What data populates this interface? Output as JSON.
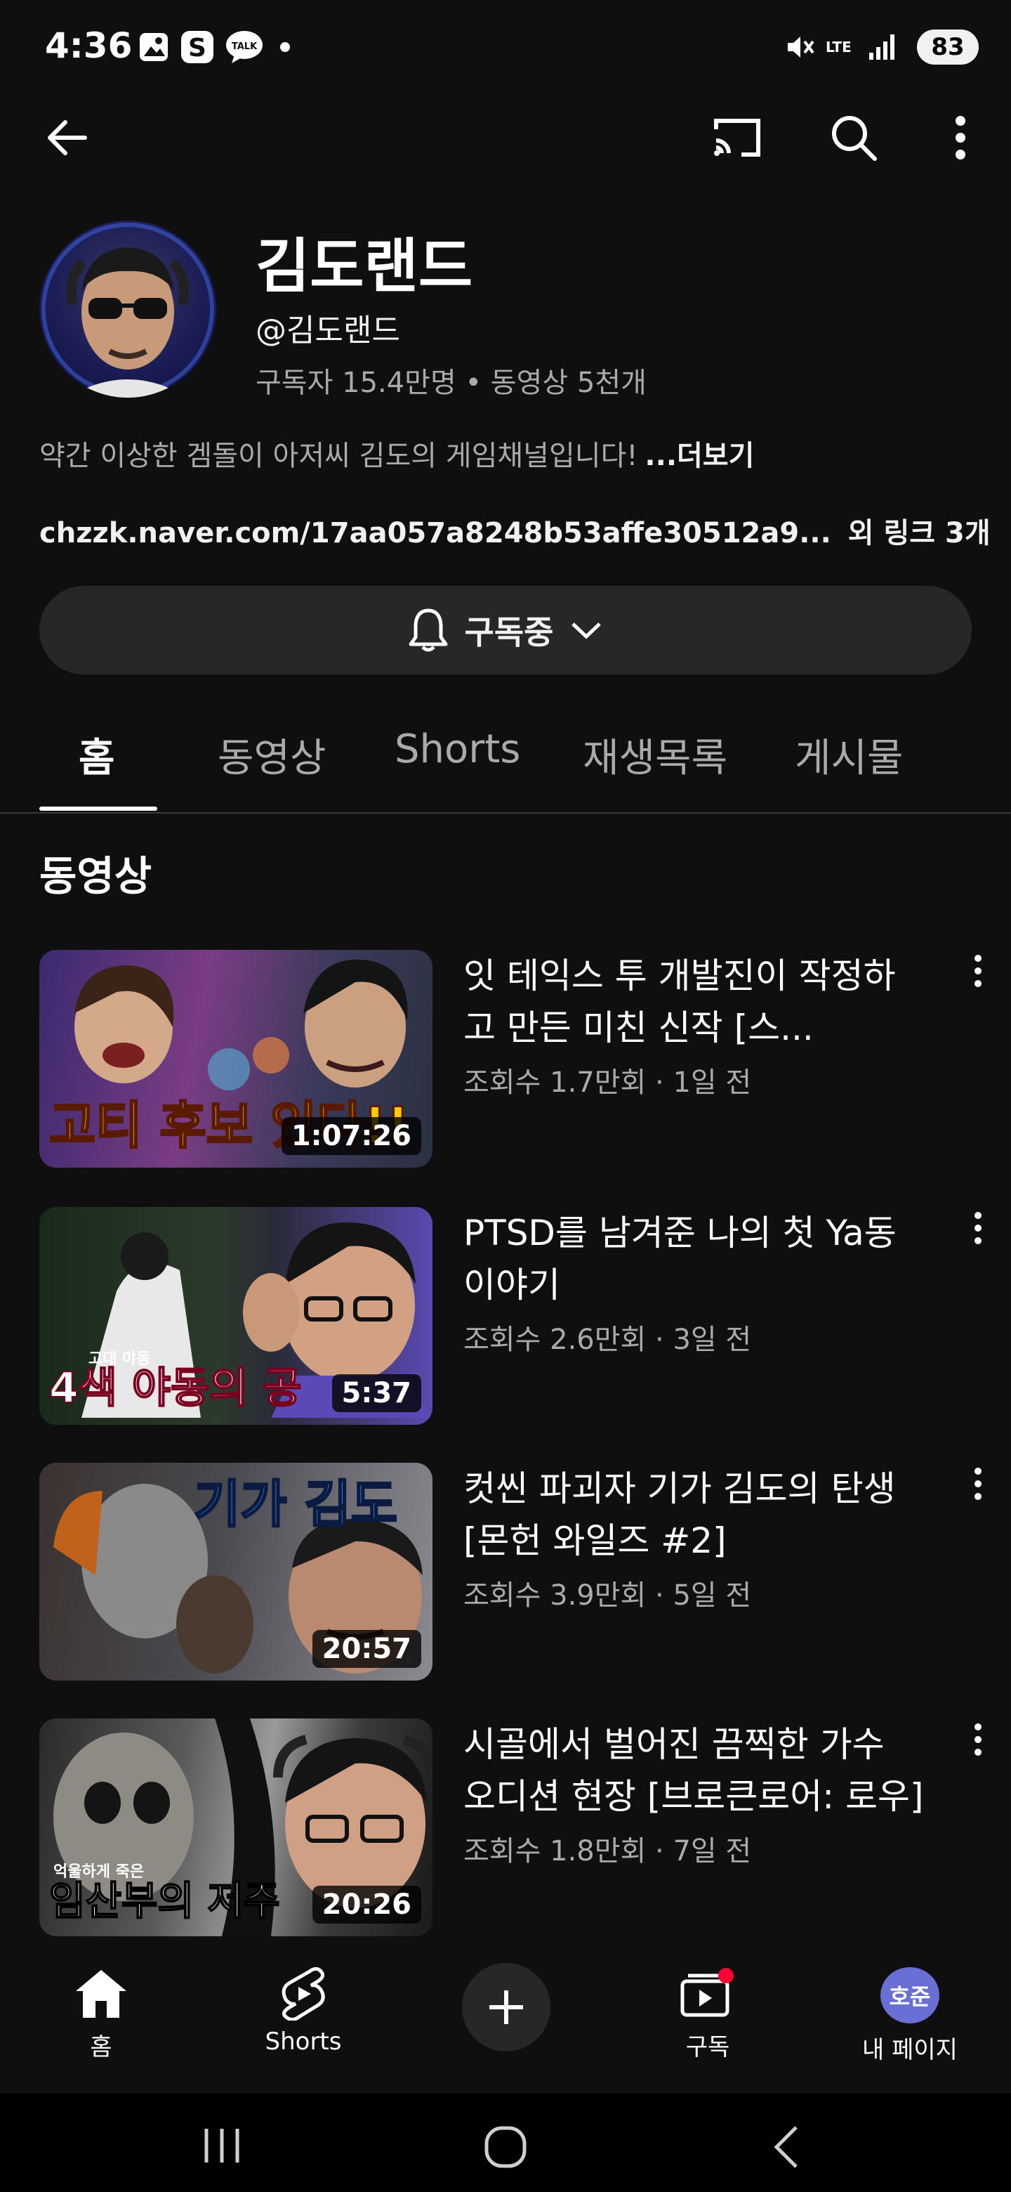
{
  "status_bar": {
    "time": "4:36",
    "battery": "83",
    "network": "LTE"
  },
  "channel": {
    "name": "김도랜드",
    "handle": "@김도랜드",
    "meta": "구독자 15.4만명 • 동영상 5천개",
    "description": "약간 이상한 겜돌이 아저씨 김도의 게임채널입니다!",
    "more_label": "...더보기",
    "link": "chzzk.naver.com/17aa057a8248b53affe30512a9...",
    "extra_links": "외 링크 3개",
    "subscribe_label": "구독중"
  },
  "tabs": [
    {
      "label": "홈",
      "active": true
    },
    {
      "label": "동영상"
    },
    {
      "label": "Shorts"
    },
    {
      "label": "재생목록"
    },
    {
      "label": "게시물"
    }
  ],
  "section_title": "동영상",
  "videos": [
    {
      "title": "잇 테익스 투 개발진이 작정하고 만든 미친 신작 [스...",
      "meta": "조회수 1.7만회 · 1일 전",
      "duration": "1:07:26",
      "thumb_text": "고티 후보 있다!!"
    },
    {
      "title": "PTSD를 남겨준 나의 첫 Ya동 이야기",
      "meta": "조회수 2.6만회 · 3일 전",
      "duration": "5:37",
      "thumb_text": "4색 야동의 공",
      "thumb_small": "고대 야동"
    },
    {
      "title": "컷씬 파괴자 기가 김도의 탄생 [몬헌 와일즈 #2]",
      "meta": "조회수 3.9만회 · 5일 전",
      "duration": "20:57",
      "thumb_text": "기가 김도"
    },
    {
      "title": "시골에서 벌어진 끔찍한 가수 오디션 현장 [브로큰로어: 로우]",
      "meta": "조회수 1.8만회 · 7일 전",
      "duration": "20:26",
      "thumb_text": "임산부의 저주",
      "thumb_small": "억울하게 죽은"
    }
  ],
  "bottom_nav": {
    "home": "홈",
    "shorts": "Shorts",
    "subscriptions": "구독",
    "me": "내 페이지",
    "me_avatar": "호준"
  },
  "colors": {
    "background": "#0f0f0f",
    "surface": "#272727",
    "secondary_text": "#aaaaaa",
    "notification_dot": "#ff0033",
    "me_avatar": "#6a6fd6"
  }
}
